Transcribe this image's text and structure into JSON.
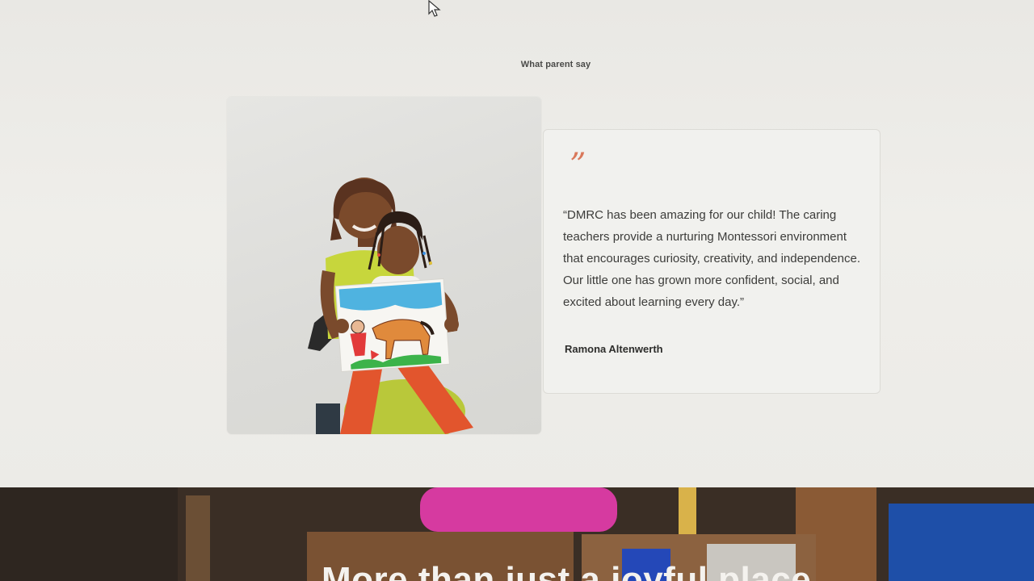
{
  "testimonials": {
    "section_heading": "What parent say",
    "quote_mark": "”",
    "quote_text": "“DMRC has been amazing for our child! The caring teachers provide a nurturing Montessori environment that encourages curiosity, creativity, and independence. Our little one has grown more confident, social, and excited about learning every day.”",
    "author": "Ramona Altenwerth",
    "photo_icon": "parent-and-child-photo"
  },
  "banner": {
    "title": "More than just a joyful place"
  },
  "colors": {
    "accent_quote": "#d9785a",
    "section_bg": "#ecebe7",
    "card_bg": "#f1f1ee",
    "banner_bg": "#3b2f26"
  }
}
